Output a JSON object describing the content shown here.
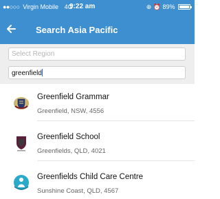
{
  "status_bar": {
    "signal": "●●○○○",
    "carrier": "Virgin Mobile",
    "network": "4G",
    "time": "9:22 am",
    "icons": "⊕ ⏰",
    "battery": "89%",
    "battery_level": 0.89
  },
  "header": {
    "title": "Search Asia Pacific",
    "back_icon": "arrow-left-icon",
    "color": "#3d8fd0"
  },
  "search": {
    "region_placeholder": "Select Region",
    "query_value": "greenfield"
  },
  "results": [
    {
      "name": "Greenfield Grammar",
      "location": "Greenfield, NSW, 4556",
      "logo": "crest-logo-icon"
    },
    {
      "name": "Greenfield School",
      "location": "Greenfields, QLD, 4021",
      "logo": "shield-logo-icon"
    },
    {
      "name": "Greenfields Child Care Centre",
      "location": "Sunshine Coast, QLD, 4567",
      "logo": "child-care-logo-icon"
    }
  ]
}
